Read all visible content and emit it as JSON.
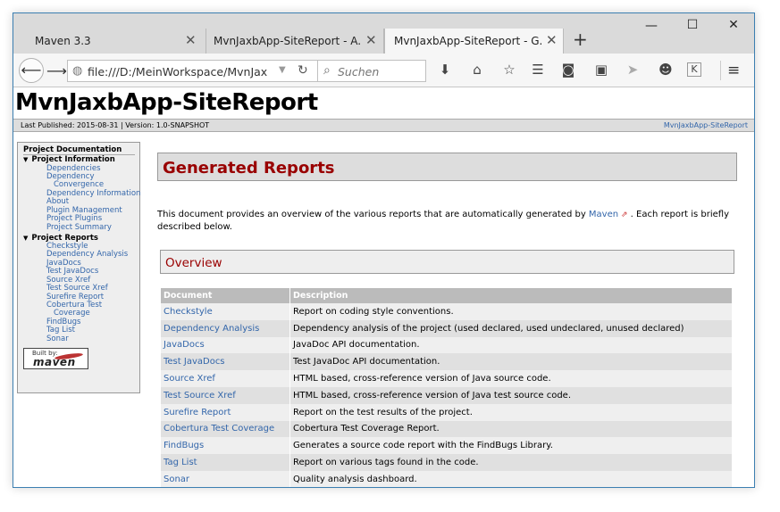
{
  "browser": {
    "tabs": [
      {
        "label": "Maven 3.3",
        "active": false
      },
      {
        "label": "MvnJaxbApp-SiteReport - A...",
        "active": false
      },
      {
        "label": "MvnJaxbApp-SiteReport - G...",
        "active": true
      }
    ],
    "close_glyph": "✕",
    "new_tab_glyph": "+",
    "window_controls": {
      "minimize": "—",
      "maximize": "☐",
      "close": "✕"
    },
    "url": "file:///D:/MeinWorkspace/MvnJax",
    "search_placeholder": "Suchen",
    "icons": [
      "download-icon",
      "home-icon",
      "bookmark-star-icon",
      "reader-list-icon",
      "pocket-icon",
      "screenshot-icon",
      "send-icon",
      "smiley-icon",
      "k-extension-icon",
      "hamburger-menu-icon"
    ]
  },
  "site": {
    "title": "MvnJaxbApp-SiteReport",
    "published": "Last Published: 2015-08-31  | Version: 1.0-SNAPSHOT",
    "breadcrumb_link": "MvnJaxbApp-SiteReport"
  },
  "menu": {
    "heading": "Project Documentation",
    "project_information": {
      "label": "Project Information",
      "items": [
        "Dependencies",
        "Dependency",
        "Convergence",
        "Dependency Information",
        "About",
        "Plugin Management",
        "Project Plugins",
        "Project Summary"
      ]
    },
    "project_reports": {
      "label": "Project Reports",
      "items": [
        "Checkstyle",
        "Dependency Analysis",
        "JavaDocs",
        "Test JavaDocs",
        "Source Xref",
        "Test Source Xref",
        "Surefire Report",
        "Cobertura Test",
        "Coverage",
        "FindBugs",
        "Tag List",
        "Sonar"
      ]
    },
    "built_by_label": "Built by:",
    "built_by_logo": "maven"
  },
  "main": {
    "heading": "Generated Reports",
    "intro_before": "This document provides an overview of the various reports that are automatically generated by ",
    "intro_link": "Maven",
    "intro_after": " . Each report is briefly described below.",
    "overview_heading": "Overview",
    "table": {
      "headers": [
        "Document",
        "Description"
      ],
      "rows": [
        {
          "doc": "Checkstyle",
          "desc": "Report on coding style conventions."
        },
        {
          "doc": "Dependency Analysis",
          "desc": "Dependency analysis of the project (used declared, used undeclared, unused declared)"
        },
        {
          "doc": "JavaDocs",
          "desc": "JavaDoc API documentation."
        },
        {
          "doc": "Test JavaDocs",
          "desc": "Test JavaDoc API documentation."
        },
        {
          "doc": "Source Xref",
          "desc": "HTML based, cross-reference version of Java source code."
        },
        {
          "doc": "Test Source Xref",
          "desc": "HTML based, cross-reference version of Java test source code."
        },
        {
          "doc": "Surefire Report",
          "desc": "Report on the test results of the project."
        },
        {
          "doc": "Cobertura Test Coverage",
          "desc": "Cobertura Test Coverage Report."
        },
        {
          "doc": "FindBugs",
          "desc": "Generates a source code report with the FindBugs Library."
        },
        {
          "doc": "Tag List",
          "desc": "Report on various tags found in the code."
        },
        {
          "doc": "Sonar",
          "desc": "Quality analysis dashboard."
        }
      ]
    }
  },
  "colors": {
    "link": "#3366aa",
    "heading": "#990000",
    "window_border": "#3c7fb1"
  }
}
